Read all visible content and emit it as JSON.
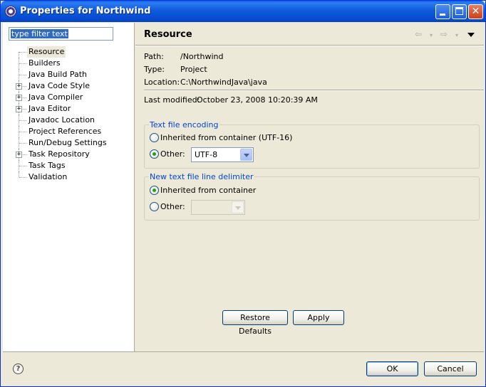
{
  "window": {
    "title": "Properties for Northwind",
    "icon": "eclipse-icon"
  },
  "filter": {
    "text": "type filter text"
  },
  "tree": {
    "items": [
      {
        "label": "Resource",
        "expandable": false,
        "selected": true
      },
      {
        "label": "Builders",
        "expandable": false
      },
      {
        "label": "Java Build Path",
        "expandable": false
      },
      {
        "label": "Java Code Style",
        "expandable": true
      },
      {
        "label": "Java Compiler",
        "expandable": true
      },
      {
        "label": "Java Editor",
        "expandable": true
      },
      {
        "label": "Javadoc Location",
        "expandable": false
      },
      {
        "label": "Project References",
        "expandable": false
      },
      {
        "label": "Run/Debug Settings",
        "expandable": false
      },
      {
        "label": "Task Repository",
        "expandable": true
      },
      {
        "label": "Task Tags",
        "expandable": false
      },
      {
        "label": "Validation",
        "expandable": false
      }
    ],
    "expander_glyph": "+"
  },
  "page": {
    "title": "Resource",
    "nav_back": "⇦",
    "nav_forward": "⇨",
    "nav_dropdown": "▾"
  },
  "info": {
    "path_label": "Path:",
    "path_value": "/Northwind",
    "type_label": "Type:",
    "type_value": "Project",
    "location_label": "Location:",
    "location_value": "C:\\NorthwindJava\\java",
    "modified_label": "Last modified:",
    "modified_value": "October 23, 2008 10:20:39 AM"
  },
  "encoding": {
    "legend": "Text file encoding",
    "inherited_label": "Inherited from container (UTF-16)",
    "inherited_selected": false,
    "other_label": "Other:",
    "other_selected": true,
    "other_value": "UTF-8"
  },
  "delimiter": {
    "legend": "New text file line delimiter",
    "inherited_label": "Inherited from container",
    "inherited_selected": true,
    "other_label": "Other:",
    "other_selected": false,
    "other_value": ""
  },
  "buttons": {
    "restore_defaults": "Restore Defaults",
    "apply": "Apply",
    "ok": "OK",
    "cancel": "Cancel",
    "help": "?"
  },
  "colors": {
    "titlebar": "#0A5FE6",
    "dialog_bg": "#ECE9D8",
    "group_legend": "#0046D5",
    "selection": "#316AC5"
  }
}
